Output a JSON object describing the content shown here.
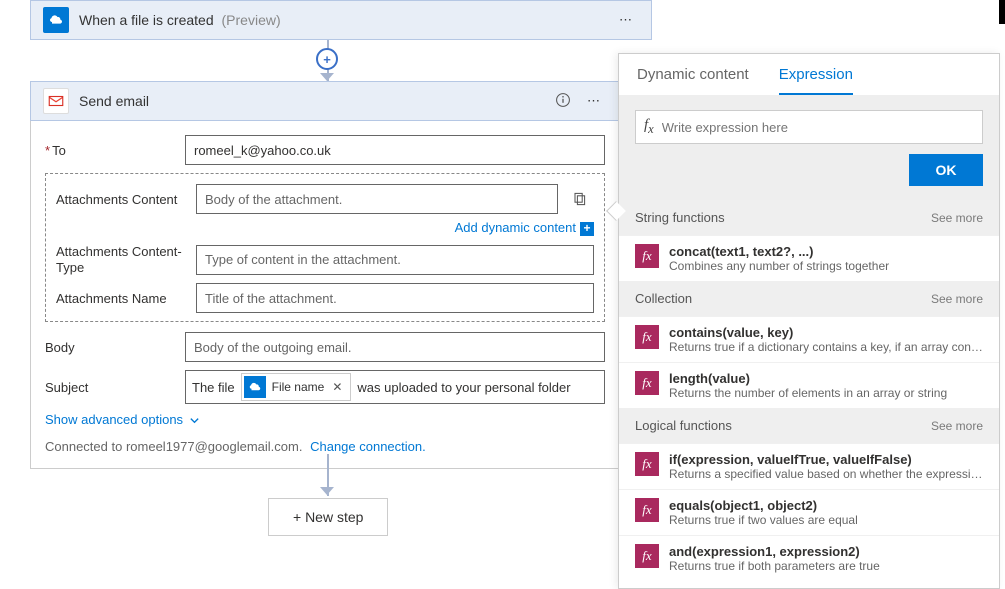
{
  "trigger": {
    "title": "When a file is created",
    "titleSuffix": "(Preview)"
  },
  "action": {
    "title": "Send email",
    "fields": {
      "to": {
        "label": "To",
        "value": "romeel_k@yahoo.co.uk"
      },
      "attContent": {
        "label": "Attachments Content",
        "placeholder": "Body of the attachment."
      },
      "attContentType": {
        "label": "Attachments Content-Type",
        "placeholder": "Type of content in the attachment."
      },
      "attName": {
        "label": "Attachments Name",
        "placeholder": "Title of the attachment."
      },
      "body": {
        "label": "Body",
        "placeholder": "Body of the outgoing email."
      },
      "subject": {
        "label": "Subject",
        "prefix": "The file",
        "tokenLabel": "File name",
        "suffix": "was uploaded to your personal folder"
      }
    },
    "addDynamicContent": "Add dynamic content",
    "advancedLabel": "Show advanced options",
    "connectedPrefix": "Connected to ",
    "connectedAccount": "romeel1977@googlemail.com.",
    "changeConnection": "Change connection."
  },
  "newStepLabel": "+ New step",
  "rightPanel": {
    "tabs": {
      "dynamic": "Dynamic content",
      "expression": "Expression"
    },
    "exprPlaceholder": "Write expression here",
    "okLabel": "OK",
    "seeMoreLabel": "See more",
    "categories": [
      {
        "name": "String functions",
        "functions": [
          {
            "sig": "concat(text1, text2?, ...)",
            "desc": "Combines any number of strings together"
          }
        ]
      },
      {
        "name": "Collection",
        "functions": [
          {
            "sig": "contains(value, key)",
            "desc": "Returns true if a dictionary contains a key, if an array cont..."
          },
          {
            "sig": "length(value)",
            "desc": "Returns the number of elements in an array or string"
          }
        ]
      },
      {
        "name": "Logical functions",
        "functions": [
          {
            "sig": "if(expression, valueIfTrue, valueIfFalse)",
            "desc": "Returns a specified value based on whether the expressio..."
          },
          {
            "sig": "equals(object1, object2)",
            "desc": "Returns true if two values are equal"
          },
          {
            "sig": "and(expression1, expression2)",
            "desc": "Returns true if both parameters are true"
          }
        ]
      }
    ]
  }
}
